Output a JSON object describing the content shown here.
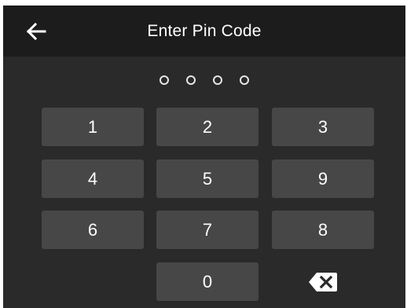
{
  "header": {
    "title": "Enter Pin Code",
    "back_icon": "arrow-left-icon"
  },
  "pin": {
    "length": 4,
    "filled": 0
  },
  "keypad": {
    "rows": [
      [
        "1",
        "2",
        "3"
      ],
      [
        "4",
        "5",
        "9"
      ],
      [
        "6",
        "7",
        "8"
      ],
      [
        "",
        "0",
        ""
      ]
    ],
    "backspace_icon": "backspace-icon"
  },
  "colors": {
    "background": "#2a2a2a",
    "header": "#1c1c1c",
    "key": "#474747",
    "text": "#ffffff"
  }
}
